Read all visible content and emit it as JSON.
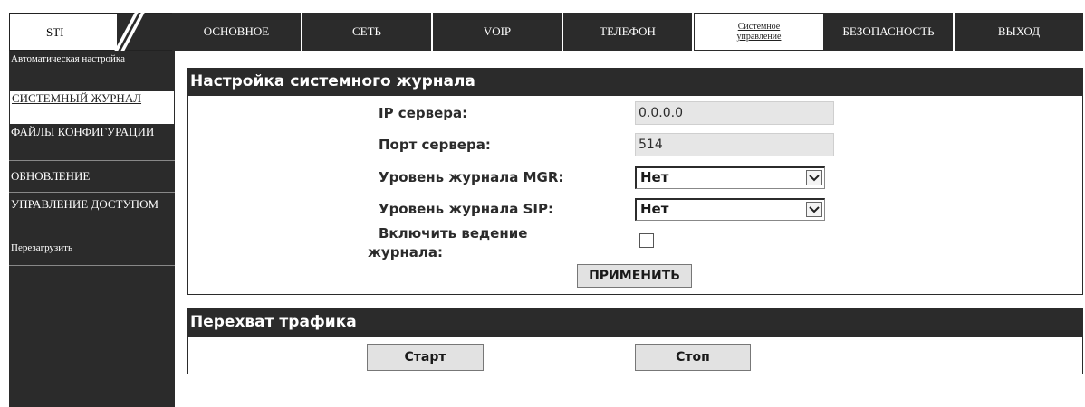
{
  "logo": {
    "text": "STI"
  },
  "topnav": {
    "tabs": [
      {
        "label": "ОСНОВНОЕ"
      },
      {
        "label": "СЕТЬ"
      },
      {
        "label": "VOIP"
      },
      {
        "label": "ТЕЛЕФОН"
      },
      {
        "label": "Системное управление",
        "active": true
      },
      {
        "label": "БЕЗОПАСНОСТЬ"
      },
      {
        "label": "ВЫХОД"
      }
    ]
  },
  "sidebar": {
    "items": [
      {
        "label": "Автоматическая настройка"
      },
      {
        "label": "СИСТЕМНЫЙ ЖУРНАЛ",
        "active": true
      },
      {
        "label": "ФАЙЛЫ КОНФИГУРАЦИИ"
      },
      {
        "label": "ОБНОВЛЕНИЕ"
      },
      {
        "label": "УПРАВЛЕНИЕ ДОСТУПОМ"
      },
      {
        "label": "Перезагрузить"
      }
    ]
  },
  "syslog": {
    "title": "Настройка системного журнала",
    "server_ip_label": "IP сервера:",
    "server_ip_value": "0.0.0.0",
    "server_port_label": "Порт сервера:",
    "server_port_value": "514",
    "mgr_level_label": "Уровень журнала MGR:",
    "mgr_level_value": "Нет",
    "sip_level_label": "Уровень журнала SIP:",
    "sip_level_value": "Нет",
    "enable_label_line1": "Включить ведение",
    "enable_label_line2": "журнала:",
    "enable_checked": false,
    "apply_button": "ПРИМЕНИТЬ"
  },
  "capture": {
    "title": "Перехват трафика",
    "start_button": "Старт",
    "stop_button": "Стоп"
  }
}
